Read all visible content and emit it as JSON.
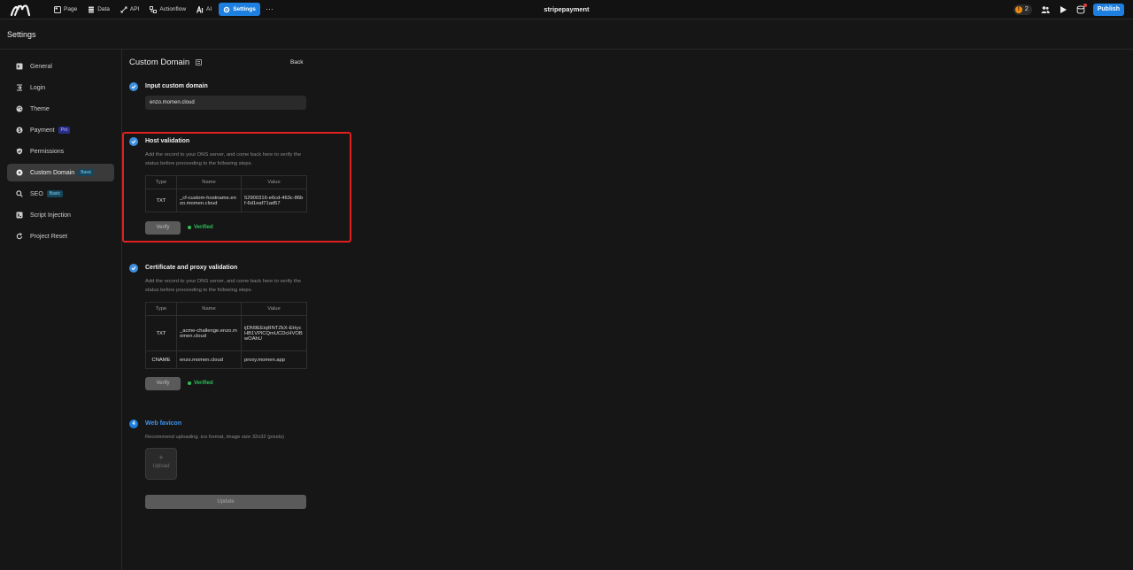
{
  "topbar": {
    "nav": [
      {
        "label": "Page",
        "icon": "page-icon"
      },
      {
        "label": "Data",
        "icon": "database-icon"
      },
      {
        "label": "API",
        "icon": "api-icon"
      },
      {
        "label": "Actionflow",
        "icon": "actionflow-icon"
      },
      {
        "label": "AI",
        "icon": "ai-icon"
      },
      {
        "label": "Settings",
        "icon": "gear-icon",
        "active": true
      }
    ],
    "more": "⋯",
    "project_name": "stripepayment",
    "notification_count": "2",
    "publish_label": "Publish"
  },
  "settings_header": {
    "title": "Settings"
  },
  "sidebar": {
    "items": [
      {
        "label": "General",
        "icon": "terminal-icon"
      },
      {
        "label": "Login",
        "icon": "login-icon"
      },
      {
        "label": "Theme",
        "icon": "palette-icon"
      },
      {
        "label": "Payment",
        "icon": "dollar-icon",
        "tag": "Pro"
      },
      {
        "label": "Permissions",
        "icon": "shield-icon"
      },
      {
        "label": "Custom Domain",
        "icon": "globe-icon",
        "tag": "Basic",
        "active": true
      },
      {
        "label": "SEO",
        "icon": "search-icon",
        "tag": "Basic"
      },
      {
        "label": "Script Injection",
        "icon": "code-icon"
      },
      {
        "label": "Project Reset",
        "icon": "reset-icon"
      }
    ]
  },
  "main": {
    "title": "Custom Domain",
    "back_label": "Back",
    "step1": {
      "title": "Input custom domain",
      "value": "enzo.momen.cloud"
    },
    "step2": {
      "title": "Host validation",
      "desc": "Add the record to your DNS server, and come back here to verify the status before proceeding to the following steps.",
      "headers": [
        "Type",
        "Name",
        "Value"
      ],
      "rows": [
        {
          "type": "TXT",
          "name": "_cf-custom-hostname.enzo.momen.cloud",
          "value": "52900316-e6cd-463c-86bf-6d1eaf71ad57"
        }
      ],
      "verify_label": "Verify",
      "status": "Verified"
    },
    "step3": {
      "title": "Certificate and proxy validation",
      "desc": "Add the record to your DNS server, and come back here to verify the status before proceeding to the following steps.",
      "headers": [
        "Type",
        "Name",
        "Value"
      ],
      "rows": [
        {
          "type": "TXT",
          "name": "_acme-challenge.enzo.momen.cloud",
          "value": "ijDN9EEiqRNTZkX-EHycHB1VPlCQmUCDcHVOBwOAhU"
        },
        {
          "type": "CNAME",
          "name": "enzo.momen.cloud",
          "value": "proxy.momen.app"
        }
      ],
      "verify_label": "Verify",
      "status": "Verified"
    },
    "step4": {
      "number": "4",
      "title": "Web favicon",
      "desc": "Recommend uploading .ico format, image size 32x32 (pixels)",
      "upload_label": "Upload",
      "plus": "+",
      "update_label": "Update"
    }
  },
  "colors": {
    "accent": "#1d7fe0",
    "success": "#2fbf5a",
    "highlight": "#e0201f"
  }
}
